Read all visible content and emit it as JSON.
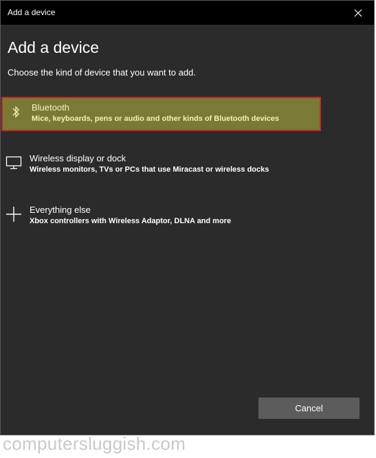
{
  "window": {
    "title": "Add a device"
  },
  "page": {
    "heading": "Add a device",
    "subtitle": "Choose the kind of device that you want to add."
  },
  "options": [
    {
      "title": "Bluetooth",
      "description": "Mice, keyboards, pens or audio and other kinds of Bluetooth devices",
      "icon": "bluetooth-icon",
      "selected": true
    },
    {
      "title": "Wireless display or dock",
      "description": "Wireless monitors, TVs or PCs that use Miracast or wireless docks",
      "icon": "monitor-icon",
      "selected": false
    },
    {
      "title": "Everything else",
      "description": "Xbox controllers with Wireless Adaptor, DLNA and more",
      "icon": "plus-icon",
      "selected": false
    }
  ],
  "footer": {
    "cancel_label": "Cancel"
  },
  "watermark": "computersluggish.com",
  "colors": {
    "background": "#2b2b2b",
    "titlebar": "#000000",
    "selected_fill": "#7a7a36",
    "selected_border": "#c22a2a",
    "button": "#5c5c5c"
  }
}
